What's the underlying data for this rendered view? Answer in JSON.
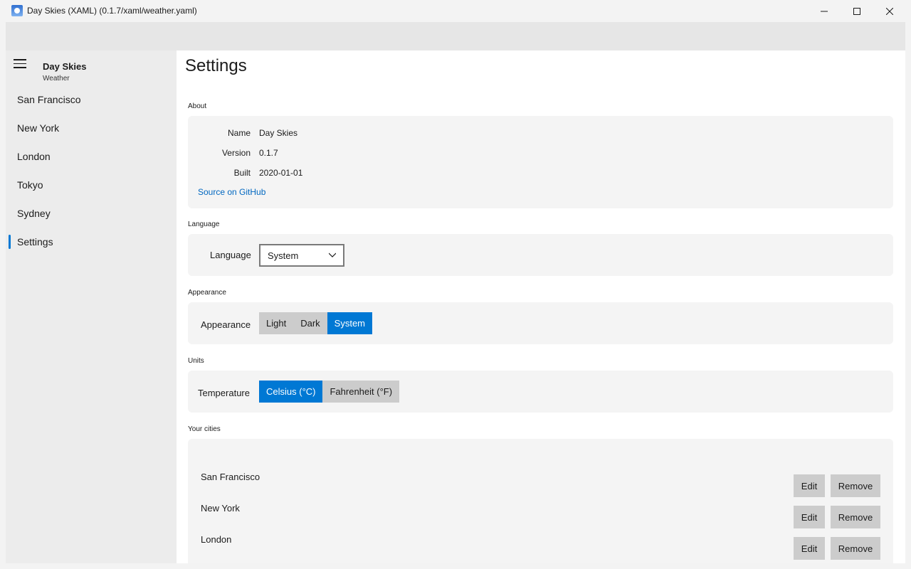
{
  "window": {
    "title": "Day Skies (XAML) (0.1.7/xaml/weather.yaml)"
  },
  "sidebar": {
    "app_name": "Day Skies",
    "app_subtitle": "Weather",
    "items": [
      {
        "label": "San Francisco",
        "active": false
      },
      {
        "label": "New York",
        "active": false
      },
      {
        "label": "London",
        "active": false
      },
      {
        "label": "Tokyo",
        "active": false
      },
      {
        "label": "Sydney",
        "active": false
      },
      {
        "label": "Settings",
        "active": true
      }
    ]
  },
  "main": {
    "title": "Settings",
    "about": {
      "section": "About",
      "name_label": "Name",
      "name_value": "Day Skies",
      "version_label": "Version",
      "version_value": "0.1.7",
      "built_label": "Built",
      "built_value": "2020-01-01",
      "source_link": "Source on GitHub"
    },
    "language": {
      "section": "Language",
      "label": "Language",
      "selected": "System"
    },
    "appearance": {
      "section": "Appearance",
      "label": "Appearance",
      "options": [
        "Light",
        "Dark",
        "System"
      ],
      "selected": "System"
    },
    "units": {
      "section": "Units",
      "label": "Temperature",
      "options": [
        "Celsius (°C)",
        "Fahrenheit (°F)"
      ],
      "selected": "Celsius (°C)"
    },
    "cities": {
      "section": "Your cities",
      "edit_label": "Edit",
      "remove_label": "Remove",
      "list": [
        "San Francisco",
        "New York",
        "London"
      ]
    }
  },
  "colors": {
    "accent": "#0078d4",
    "link": "#0067c0"
  }
}
